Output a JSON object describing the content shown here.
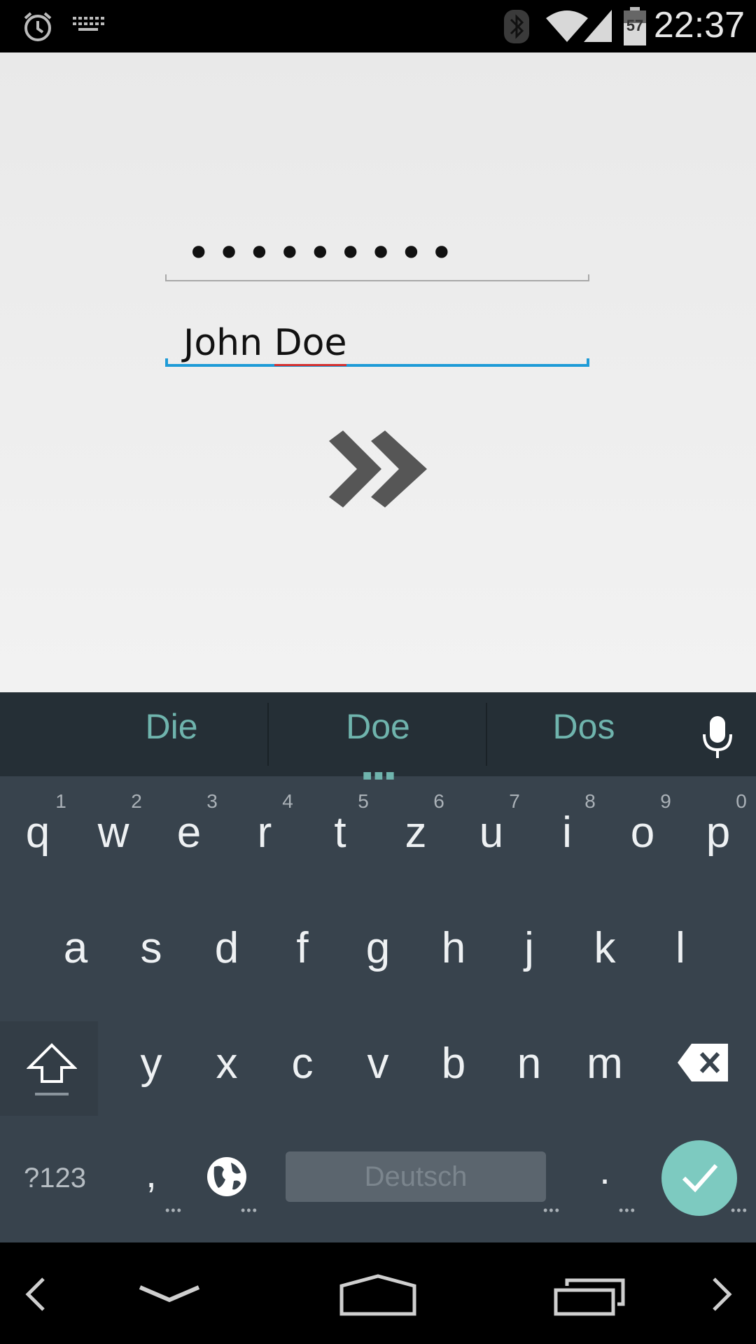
{
  "status_bar": {
    "time": "22:37",
    "battery_level": "57",
    "icons": [
      "alarm-icon",
      "keyboard-icon",
      "bluetooth-icon",
      "wifi-icon",
      "signal-icon",
      "battery-icon"
    ]
  },
  "form": {
    "password_value": "•••••••••",
    "name_value_first": "John ",
    "name_value_second": "Doe",
    "next_icon": "double-chevron-right-icon"
  },
  "keyboard": {
    "suggestions": [
      "Die",
      "Doe",
      "Dos"
    ],
    "row1": [
      "q",
      "w",
      "e",
      "r",
      "t",
      "z",
      "u",
      "i",
      "o",
      "p"
    ],
    "row1_hints": [
      "1",
      "2",
      "3",
      "4",
      "5",
      "6",
      "7",
      "8",
      "9",
      "0"
    ],
    "row2": [
      "a",
      "s",
      "d",
      "f",
      "g",
      "h",
      "j",
      "k",
      "l"
    ],
    "row3": [
      "y",
      "x",
      "c",
      "v",
      "b",
      "n",
      "m"
    ],
    "symbols_label": "?123",
    "comma": ",",
    "period": ".",
    "space_label": "Deutsch",
    "accent_color": "#7dcac0"
  },
  "colors": {
    "field_active": "#1e9bd7",
    "spell_underline": "#d43030",
    "suggestion_text": "#6fb4ad"
  }
}
